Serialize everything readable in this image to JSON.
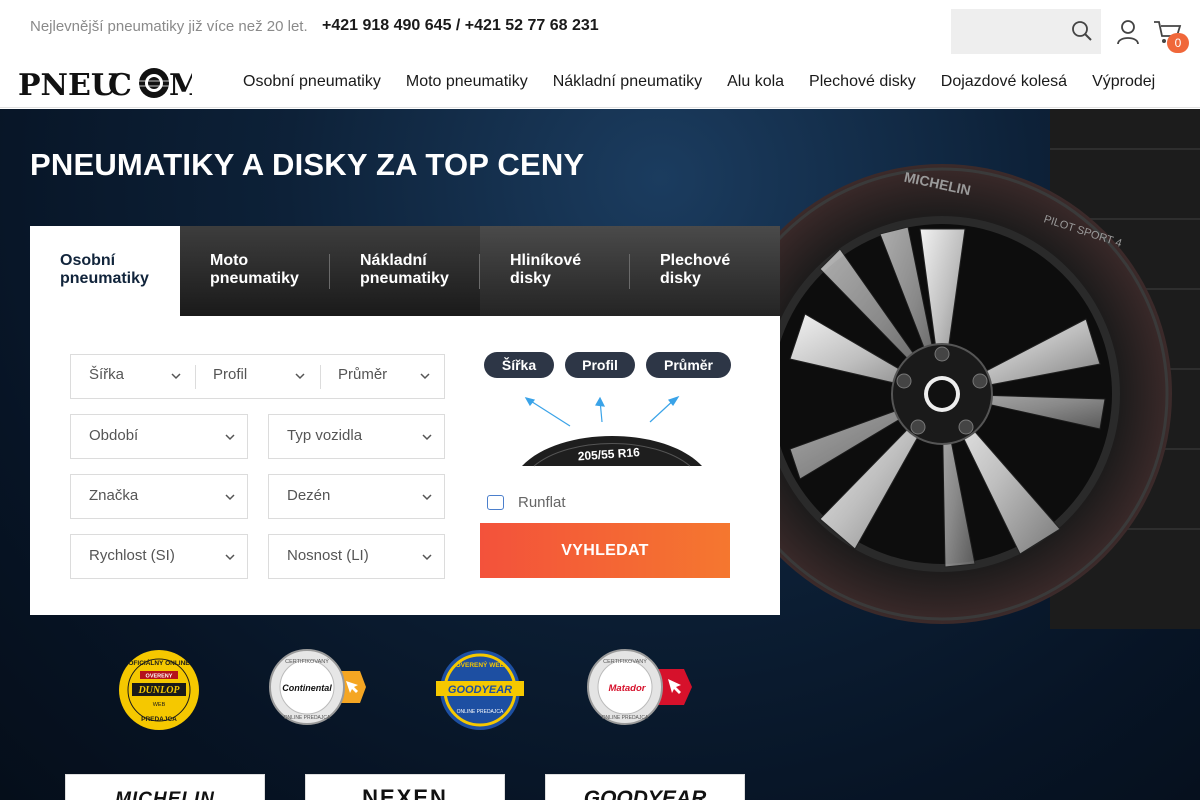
{
  "header": {
    "tagline": "Nejlevnější pneumatiky již více než 20 let.",
    "phones": "+421 918 490 645 / +421 52 77 68 231",
    "search": {
      "placeholder": "",
      "icon": "search-icon"
    },
    "account_icon": "user-icon",
    "cart": {
      "icon": "cart-icon",
      "count": "0"
    },
    "logo": "PNEUCOM"
  },
  "nav": {
    "items": [
      {
        "label": "Osobní pneumatiky"
      },
      {
        "label": "Moto pneumatiky"
      },
      {
        "label": "Nákladní pneumatiky"
      },
      {
        "label": "Alu kola"
      },
      {
        "label": "Plechové disky"
      },
      {
        "label": "Dojazdové kolesá"
      },
      {
        "label": "Výprodej"
      }
    ]
  },
  "hero": {
    "title": "PNEUMATIKY A DISKY ZA TOP CENY",
    "tire_sidewall": {
      "brand": "MICHELIN",
      "model": "PILOT SPORT 4"
    }
  },
  "tabs": [
    {
      "line1": "Osobní",
      "line2": "pneumatiky",
      "active": true
    },
    {
      "line1": "Moto",
      "line2": "pneumatiky",
      "active": false
    },
    {
      "line1": "Nákladní",
      "line2": "pneumatiky",
      "active": false
    },
    {
      "line1": "Hliníkové",
      "line2": "disky",
      "active": false
    },
    {
      "line1": "Plechové",
      "line2": "disky",
      "active": false
    }
  ],
  "form": {
    "width": "Šířka",
    "profile": "Profil",
    "diameter": "Průměr",
    "season": "Období",
    "vehicle_type": "Typ vozidla",
    "brand": "Značka",
    "pattern": "Dezén",
    "speed": "Rychlost (SI)",
    "load": "Nosnost (LI)",
    "diagram_labels": [
      "Šířka",
      "Profil",
      "Průměr"
    ],
    "diagram_size": "205/55 R16",
    "runflat": "Runflat",
    "submit": "VYHLEDAT"
  },
  "badges": [
    {
      "brand": "DUNLOP",
      "top": "OFICIÁLNY ONLINE",
      "mid": "OVERENY",
      "low": "WEB",
      "bottom": "PREDAJCA"
    },
    {
      "brand": "Continental",
      "top": "CERTIFIKOVANÝ",
      "bottom": "ONLINE PREDAJCA"
    },
    {
      "brand": "GOODYEAR",
      "top": "OVERENÝ WEB",
      "bottom": "ONLINE PREDAJCA"
    },
    {
      "brand": "Matador",
      "top": "CERTIFIKOVANÝ",
      "bottom": "ONLINE PREDAJCA"
    }
  ],
  "brand_cards": [
    "MICHELIN",
    "NEXEN",
    "GOODYEAR"
  ],
  "colors": {
    "accent": "#f3523b",
    "pill": "#2d3646",
    "hero_bg": "#0d2138"
  }
}
